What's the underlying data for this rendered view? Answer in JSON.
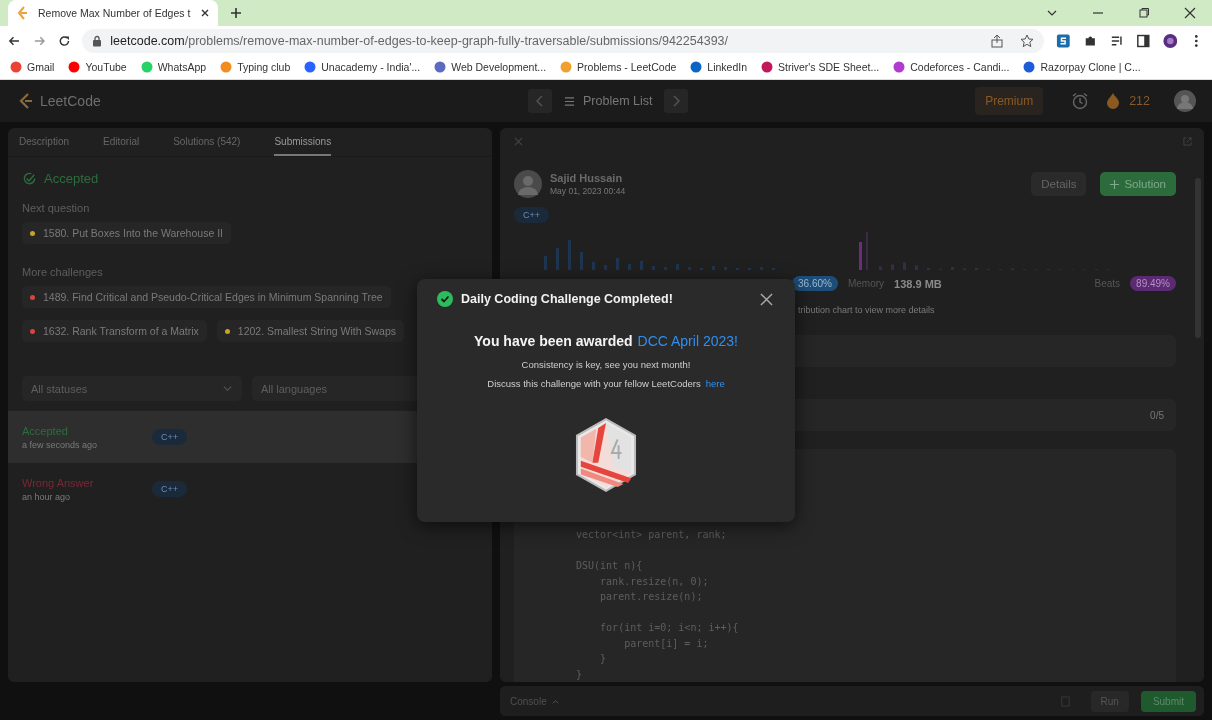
{
  "browser": {
    "tab": {
      "title": "Remove Max Number of Edges t"
    },
    "url": {
      "host": "leetcode.com",
      "path": "/problems/remove-max-number-of-edges-to-keep-graph-fully-traversable/submissions/942254393/"
    },
    "bookmarks": [
      {
        "label": "Gmail",
        "color": "#ea4335"
      },
      {
        "label": "YouTube",
        "color": "#ff0000"
      },
      {
        "label": "WhatsApp",
        "color": "#25d366"
      },
      {
        "label": "Typing club",
        "color": "#f28b20"
      },
      {
        "label": "Unacademy - India'...",
        "color": "#2962ff"
      },
      {
        "label": "Web Development...",
        "color": "#5c6bc0"
      },
      {
        "label": "Problems - LeetCode",
        "color": "#f0a030"
      },
      {
        "label": "LinkedIn",
        "color": "#0a66c2"
      },
      {
        "label": "Striver's SDE Sheet...",
        "color": "#c2185b"
      },
      {
        "label": "Codeforces - Candi...",
        "color": "#b03ccf"
      },
      {
        "label": "Razorpay Clone | C...",
        "color": "#1e5bd8"
      }
    ]
  },
  "nav": {
    "logo": "LeetCode",
    "problem_list": "Problem List",
    "premium": "Premium",
    "streak": "212"
  },
  "left": {
    "tabs": [
      {
        "label": "Description",
        "selected": false
      },
      {
        "label": "Editorial",
        "selected": false
      },
      {
        "label": "Solutions (542)",
        "selected": false
      },
      {
        "label": "Submissions",
        "selected": true
      }
    ],
    "status": "Accepted",
    "next_label": "Next question",
    "next": [
      {
        "title": "1580. Put Boxes Into the Warehouse II",
        "color": "#c9a227"
      }
    ],
    "more_label": "More challenges",
    "more": [
      {
        "title": "1489. Find Critical and Pseudo-Critical Edges in Minimum Spanning Tree",
        "color": "#d9453c"
      },
      {
        "title": "1632. Rank Transform of a Matrix",
        "color": "#d9453c"
      },
      {
        "title": "1202. Smallest String With Swaps",
        "color": "#c9a227"
      }
    ],
    "filters": [
      {
        "placeholder": "All statuses"
      },
      {
        "placeholder": "All languages"
      }
    ],
    "submissions": [
      {
        "status": "Accepted",
        "kind": "accepted",
        "time": "a few seconds ago",
        "lang": "C++",
        "selected": true
      },
      {
        "status": "Wrong Answer",
        "kind": "wrong",
        "time": "an hour ago",
        "lang": "C++",
        "selected": false
      }
    ]
  },
  "right": {
    "author": "Sajid Hussain",
    "date": "May 01, 2023 00:44",
    "details": "Details",
    "solution": "Solution",
    "lang": "C++",
    "runtime_beats": "36.60%",
    "memory_label": "Memory",
    "memory": "138.9 MB",
    "beats_label": "Beats",
    "memory_beats": "89.49%",
    "hint": "tribution chart to view more details",
    "testcases": "0/5",
    "code": [
      {
        "text": "vector<int> parent, rank;",
        "blank_before": false
      },
      {
        "text": "DSU(int n){",
        "blank_before": true
      },
      {
        "text": "    rank.resize(n, 0);",
        "blank_before": false
      },
      {
        "text": "    parent.resize(n);",
        "blank_before": false
      },
      {
        "text": "    for(int i=0; i<n; i++){",
        "blank_before": true
      },
      {
        "text": "        parent[i] = i;",
        "blank_before": false
      },
      {
        "text": "    }",
        "blank_before": false
      },
      {
        "text": "}",
        "blank_before": false
      }
    ]
  },
  "console": {
    "label": "Console",
    "run": "Run",
    "submit": "Submit"
  },
  "modal": {
    "title": "Daily Coding Challenge Completed!",
    "award_prefix": "You have been awarded",
    "award": "DCC April 2023!",
    "message": "Consistency is key, see you next month!",
    "discuss": "Discuss this challenge with your fellow LeetCoders",
    "link": "here"
  }
}
